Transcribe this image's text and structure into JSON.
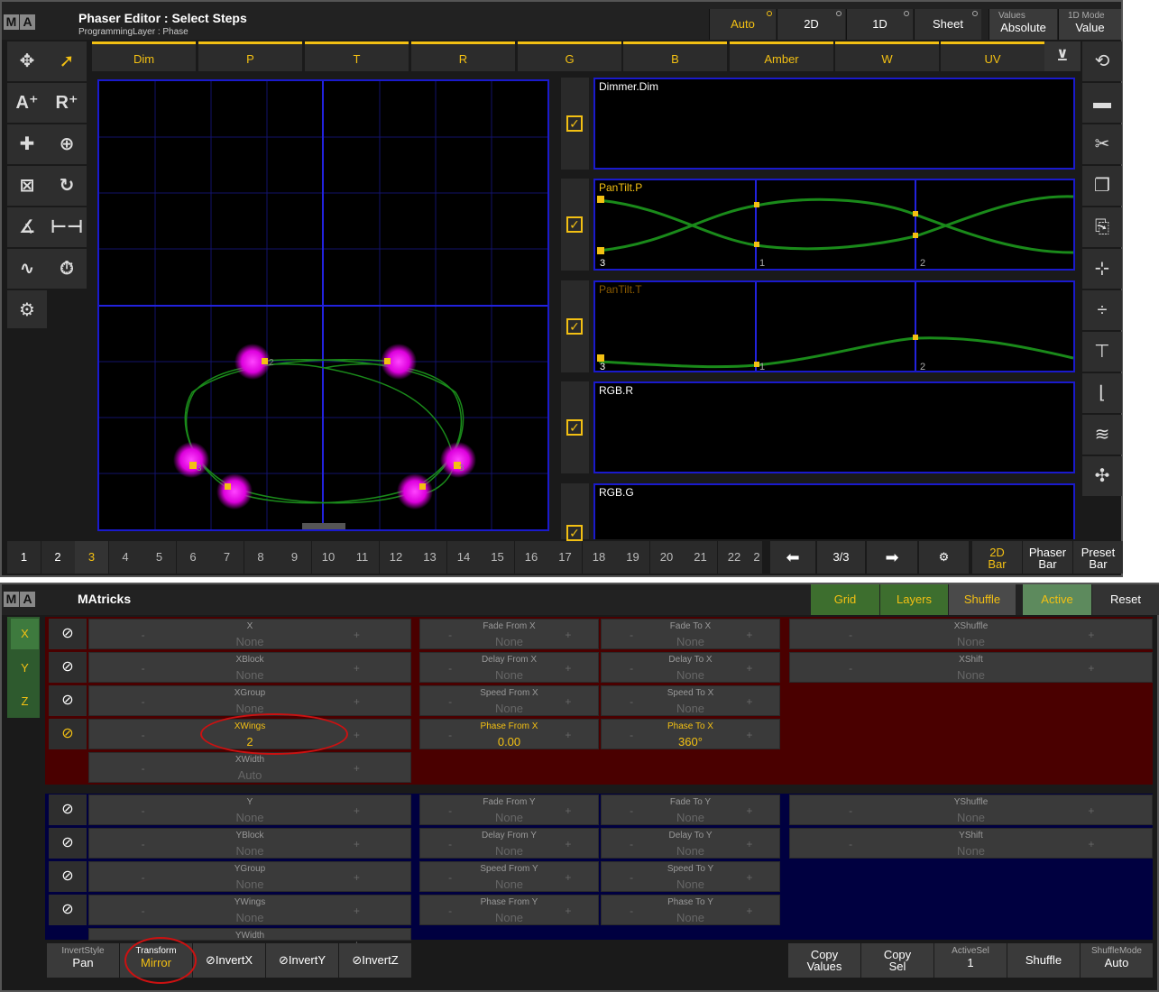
{
  "phaser": {
    "app_logo": [
      "M",
      "A"
    ],
    "title": "Phaser Editor : Select Steps",
    "subtitle": "ProgrammingLayer : Phase",
    "mode_buttons": [
      "Auto",
      "2D",
      "1D",
      "Sheet"
    ],
    "values_label": "Values",
    "values_value": "Absolute",
    "mode1d_label": "1D Mode",
    "mode1d_value": "Value",
    "attr_tabs": [
      "Dim",
      "P",
      "T",
      "R",
      "G",
      "B",
      "Amber",
      "W",
      "UV"
    ],
    "graphs": [
      "Dimmer.Dim",
      "PanTilt.P",
      "PanTilt.T",
      "RGB.R",
      "RGB.G"
    ],
    "graph_step_labels": [
      "3",
      "1",
      "2"
    ],
    "plot_step_labels": [
      "2",
      "3",
      "3"
    ],
    "steps": [
      "1",
      "2",
      "3",
      "4",
      "5",
      "6",
      "7",
      "8",
      "9",
      "10",
      "11",
      "12",
      "13",
      "14",
      "15",
      "16",
      "17",
      "18",
      "19",
      "20",
      "21",
      "22",
      "2"
    ],
    "page": "3/3",
    "bottom_buttons": [
      {
        "top": "2D",
        "bottom": "Bar"
      },
      {
        "top": "Phaser",
        "bottom": "Bar"
      },
      {
        "top": "Preset",
        "bottom": "Bar"
      }
    ]
  },
  "matricks": {
    "title": "MAtricks",
    "tabs": [
      "Grid",
      "Layers",
      "Shuffle",
      "Active",
      "Reset"
    ],
    "axes": [
      "X",
      "Y",
      "Z"
    ],
    "x_rows": [
      {
        "name": "X",
        "value": "None"
      },
      {
        "name": "XBlock",
        "value": "None"
      },
      {
        "name": "XGroup",
        "value": "None"
      },
      {
        "name": "XWings",
        "value": "2"
      },
      {
        "name": "XWidth",
        "value": "Auto"
      }
    ],
    "x_fade": [
      {
        "from": "Fade From X",
        "fromv": "None",
        "to": "Fade To X",
        "tov": "None"
      },
      {
        "from": "Delay From X",
        "fromv": "None",
        "to": "Delay To X",
        "tov": "None"
      },
      {
        "from": "Speed From X",
        "fromv": "None",
        "to": "Speed To X",
        "tov": "None"
      },
      {
        "from": "Phase From X",
        "fromv": "0.00",
        "to": "Phase To X",
        "tov": "360°"
      }
    ],
    "x_shuffle": [
      {
        "name": "XShuffle",
        "value": "None"
      },
      {
        "name": "XShift",
        "value": "None"
      }
    ],
    "y_rows": [
      {
        "name": "Y",
        "value": "None"
      },
      {
        "name": "YBlock",
        "value": "None"
      },
      {
        "name": "YGroup",
        "value": "None"
      },
      {
        "name": "YWings",
        "value": "None"
      },
      {
        "name": "YWidth",
        "value": ""
      }
    ],
    "y_fade": [
      {
        "from": "Fade From Y",
        "fromv": "None",
        "to": "Fade To Y",
        "tov": "None"
      },
      {
        "from": "Delay From Y",
        "fromv": "None",
        "to": "Delay To Y",
        "tov": "None"
      },
      {
        "from": "Speed From Y",
        "fromv": "None",
        "to": "Speed To Y",
        "tov": "None"
      },
      {
        "from": "Phase From Y",
        "fromv": "None",
        "to": "Phase To Y",
        "tov": "None"
      }
    ],
    "y_shuffle": [
      {
        "name": "YShuffle",
        "value": "None"
      },
      {
        "name": "YShift",
        "value": "None"
      }
    ],
    "minus": "-",
    "plus": "+",
    "invert_style_label": "InvertStyle",
    "invert_style_value": "Pan",
    "transform_label": "Transform",
    "transform_value": "Mirror",
    "inverts": [
      "InvertX",
      "InvertY",
      "InvertZ"
    ],
    "copy_values": [
      "Copy",
      "Values"
    ],
    "copy_sel": [
      "Copy",
      "Sel"
    ],
    "active_sel_label": "ActiveSel",
    "active_sel_value": "1",
    "shuffle_btn": "Shuffle",
    "shuffle_mode_label": "ShuffleMode",
    "shuffle_mode_value": "Auto"
  }
}
